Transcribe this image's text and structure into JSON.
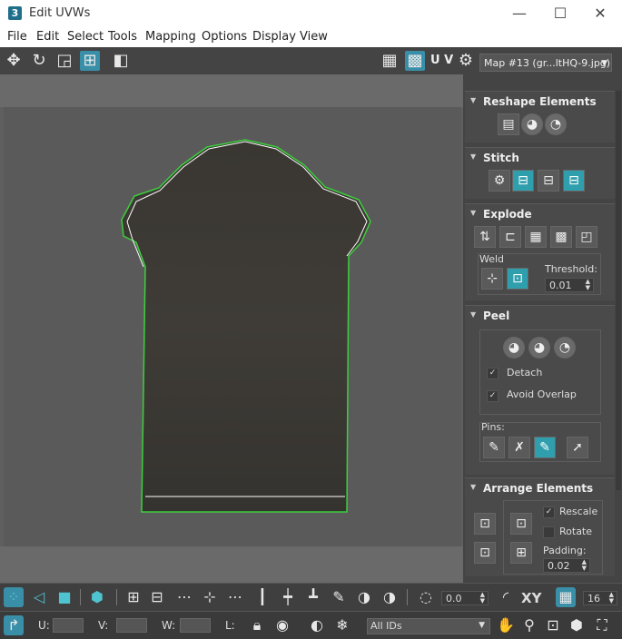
{
  "window": {
    "title": "Edit UVWs",
    "app_icon": "3",
    "minimize": "—",
    "maximize": "☐",
    "close": "✕"
  },
  "menu": [
    "File",
    "Edit",
    "Select",
    "Tools",
    "Mapping",
    "Options",
    "Display",
    "View"
  ],
  "toolbar": {
    "uv_label": "U V",
    "map_select": "Map #13 (gr...ltHQ-9.jpg)"
  },
  "rollouts": {
    "reshape": {
      "title": "Reshape Elements"
    },
    "stitch": {
      "title": "Stitch"
    },
    "explode": {
      "title": "Explode",
      "weld_label": "Weld",
      "threshold_label": "Threshold:",
      "threshold_value": "0.01"
    },
    "peel": {
      "title": "Peel",
      "detach_label": "Detach",
      "detach_checked": true,
      "avoid_overlap_label": "Avoid Overlap",
      "avoid_overlap_checked": true,
      "pins_label": "Pins:"
    },
    "arrange": {
      "title": "Arrange Elements",
      "rescale_label": "Rescale",
      "rescale_checked": true,
      "rotate_label": "Rotate",
      "rotate_checked": false,
      "padding_label": "Padding:",
      "padding_value": "0.02"
    }
  },
  "bottom": {
    "angle_value": "0.0",
    "xy_label": "XY",
    "zoom_value": "16",
    "u_label": "U:",
    "v_label": "V:",
    "w_label": "W:",
    "l_label": "L:",
    "ids_select": "All IDs"
  },
  "colors": {
    "accent": "#2f9fae",
    "selection_outline": "#3ccf3c"
  }
}
